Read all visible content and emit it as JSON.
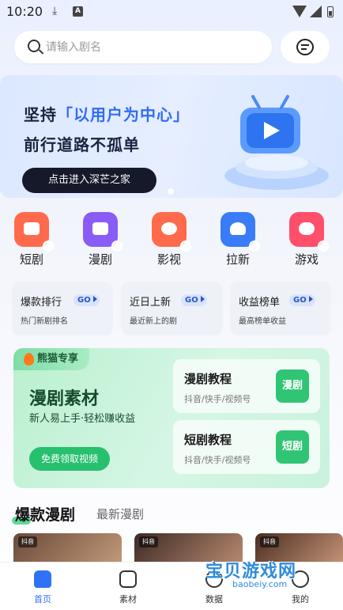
{
  "status": {
    "time": "10:20"
  },
  "search": {
    "placeholder": "请输入剧名"
  },
  "banner": {
    "line1_prefix": "坚持",
    "line1_highlight": "「以用户为中心」",
    "line2": "前行道路不孤单",
    "cta": "点击进入深芒之家"
  },
  "categories": [
    {
      "label": "短剧",
      "color": "#ff6a4d",
      "icon": "video-camera-icon"
    },
    {
      "label": "漫剧",
      "color": "#8a5cf6",
      "icon": "anime-icon"
    },
    {
      "label": "影视",
      "color": "#ff6a4d",
      "icon": "film-reel-icon"
    },
    {
      "label": "拉新",
      "color": "#3a7bf7",
      "icon": "user-add-icon"
    },
    {
      "label": "游戏",
      "color": "#ff4f6a",
      "icon": "gamepad-icon"
    }
  ],
  "ranks": [
    {
      "title": "爆款排行",
      "go": "GO",
      "sub": "热门新剧排名"
    },
    {
      "title": "近日上新",
      "go": "GO",
      "sub": "最近新上的剧"
    },
    {
      "title": "收益榜单",
      "go": "GO",
      "sub": "最高榜单收益"
    }
  ],
  "promo": {
    "tag": "熊猫专享",
    "title": "漫剧素材",
    "subtitle": "新人易上手·轻松赚收益",
    "button": "免费领取视频",
    "tutorials": [
      {
        "title": "漫剧教程",
        "sub": "抖音/快手/视频号",
        "btn": "漫剧"
      },
      {
        "title": "短剧教程",
        "sub": "抖音/快手/视频号",
        "btn": "短剧"
      }
    ]
  },
  "section": {
    "tab_active": "爆款漫剧",
    "tab_other": "最新漫剧"
  },
  "thumbnails": [
    {
      "tag": "抖音"
    },
    {
      "tag": "抖音"
    },
    {
      "tag": "抖音"
    }
  ],
  "nav": [
    {
      "label": "首页",
      "active": true
    },
    {
      "label": "素材",
      "active": false
    },
    {
      "label": "数据",
      "active": false
    },
    {
      "label": "我的",
      "active": false
    }
  ],
  "watermark": {
    "text": "宝贝游戏网",
    "url": "baobeiy.com"
  }
}
